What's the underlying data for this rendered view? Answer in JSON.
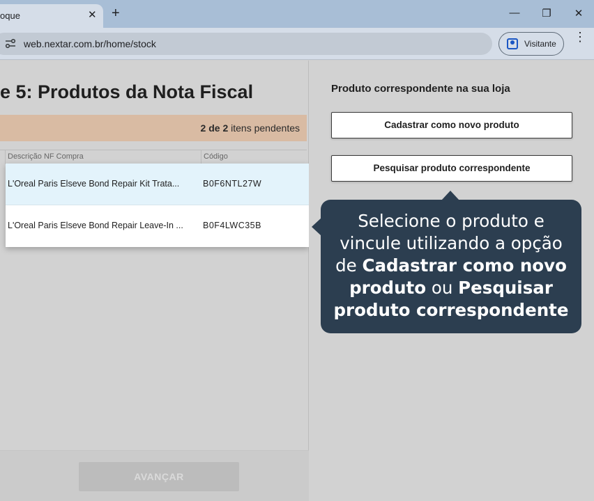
{
  "browser": {
    "tab_title": "oque",
    "tab_close": "✕",
    "new_tab": "+",
    "minimize": "—",
    "maximize": "❐",
    "close": "✕",
    "url": "web.nextar.com.br/home/stock",
    "profile_label": "Visitante",
    "menu": "⋮"
  },
  "left": {
    "step_title": "e 5: Produtos da Nota Fiscal",
    "pending": {
      "current": "2",
      "sep": "de",
      "total": "2",
      "suffix": "itens pendentes"
    },
    "columns": [
      "Descrição NF Compra",
      "Código"
    ],
    "rows": [
      {
        "description": "L'Oreal Paris Elseve Bond Repair Kit Trata...",
        "code": "B0F6NTL27W"
      },
      {
        "description": "L'Oreal Paris Elseve Bond Repair Leave-In ...",
        "code": "B0F4LWC35B"
      }
    ],
    "next_button": "AVANÇAR"
  },
  "right": {
    "heading": "Produto correspondente na sua loja",
    "btn_new": "Cadastrar como novo produto",
    "btn_search": "Pesquisar produto correspondente"
  },
  "tooltip": {
    "part1": "Selecione o produto e vincule utilizando a opção de ",
    "bold1": "Cadastrar como novo produto",
    "part2": " ou ",
    "bold2": "Pesquisar produto correspondente"
  },
  "colors": {
    "tabbar": "#a8bed6",
    "pending_bar": "#d9bba3",
    "selected_row": "#e3f3fb",
    "tooltip_bg": "#2c3e50"
  }
}
